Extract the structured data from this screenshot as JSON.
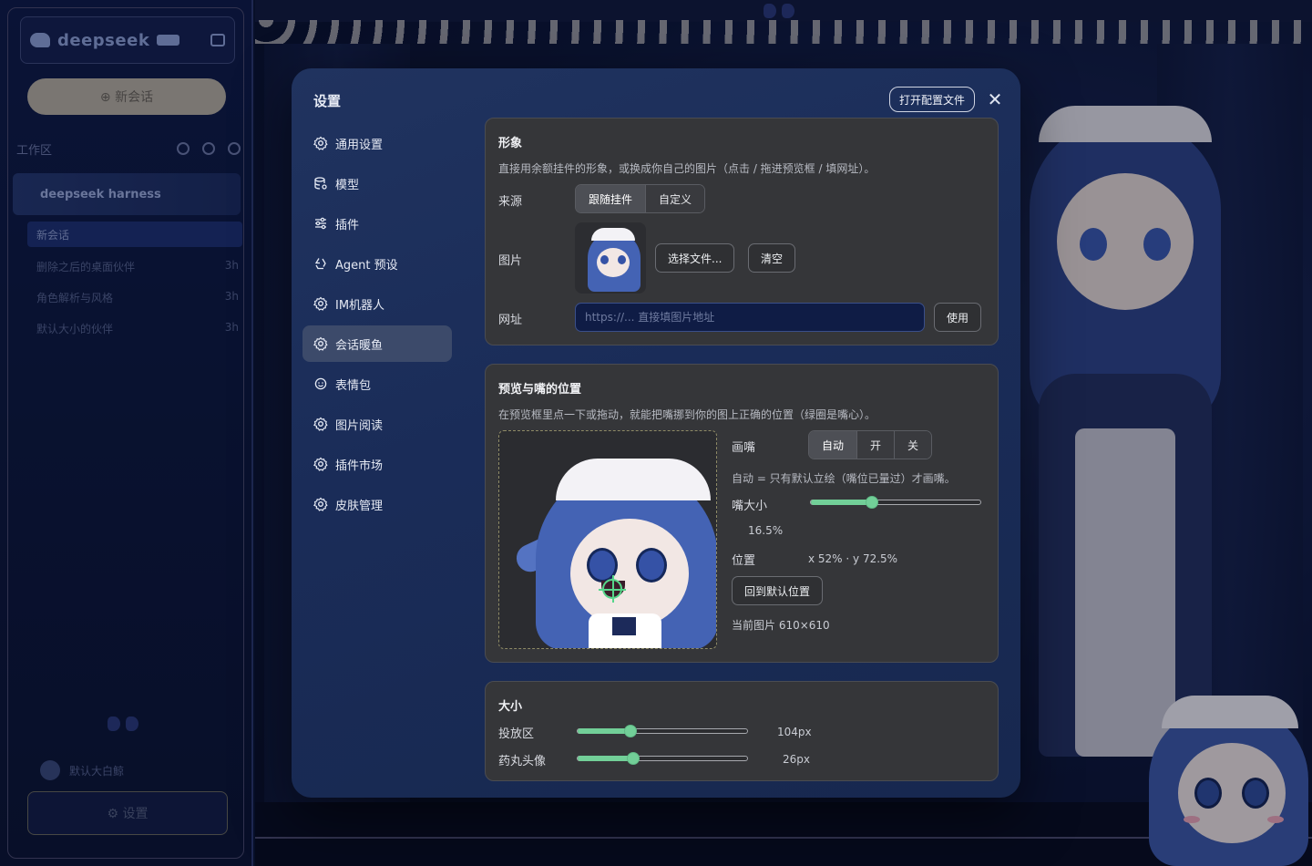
{
  "background": {
    "logo_name": "deepseek",
    "new_chat": "⊕ 新会话",
    "workspace_label": "工作区",
    "project_name": "deepseek harness",
    "session_label": "新会话",
    "sessions": [
      {
        "title": "删除之后的桌面伙伴",
        "time": "3h"
      },
      {
        "title": "角色解析与风格",
        "time": "3h"
      },
      {
        "title": "默认大小的伙伴",
        "time": "3h"
      }
    ],
    "user_name": "默认大白鲸",
    "settings_label": "⚙ 设置"
  },
  "modal": {
    "title": "设置",
    "open_config_label": "打开配置文件",
    "close_symbol": "✕",
    "nav": [
      {
        "label": "通用设置",
        "icon": "gear-icon"
      },
      {
        "label": "模型",
        "icon": "database-icon"
      },
      {
        "label": "插件",
        "icon": "sliders-icon"
      },
      {
        "label": "Agent 预设",
        "icon": "recycle-icon"
      },
      {
        "label": "IM机器人",
        "icon": "gear-icon"
      },
      {
        "label": "会话暖鱼",
        "icon": "gear-icon"
      },
      {
        "label": "表情包",
        "icon": "smile-icon"
      },
      {
        "label": "图片阅读",
        "icon": "gear-icon"
      },
      {
        "label": "插件市场",
        "icon": "gear-icon"
      },
      {
        "label": "皮肤管理",
        "icon": "gear-icon"
      }
    ],
    "active_nav": "会话暖鱼"
  },
  "appearance": {
    "title": "形象",
    "description": "直接用余额挂件的形象，或换成你自己的图片（点击 / 拖进预览框 / 填网址）。",
    "source_label": "来源",
    "source_options": [
      "跟随挂件",
      "自定义"
    ],
    "source_selected": "跟随挂件",
    "image_label": "图片",
    "choose_file_label": "选择文件...",
    "clear_label": "清空",
    "url_label": "网址",
    "url_placeholder": "https://... 直接填图片地址",
    "url_value": "",
    "use_label": "使用"
  },
  "mouth": {
    "title": "预览与嘴的位置",
    "description": "在预览框里点一下或拖动，就能把嘴挪到你的图上正确的位置（绿圈是嘴心）。",
    "draw_mouth_label": "画嘴",
    "draw_mouth_options": [
      "自动",
      "开",
      "关"
    ],
    "draw_mouth_selected": "自动",
    "auto_hint": "自动 = 只有默认立绘（嘴位已量过）才画嘴。",
    "mouth_size_label": "嘴大小",
    "mouth_size_value": "16.5%",
    "mouth_size_fraction": 0.36,
    "position_label": "位置",
    "position_value": "x 52% · y 72.5%",
    "mouth_x": 0.52,
    "mouth_y": 0.725,
    "reset_label": "回到默认位置",
    "current_image": "当前图片 610×610"
  },
  "size": {
    "title": "大小",
    "dropzone_label": "投放区",
    "dropzone_value": "104px",
    "dropzone_fraction": 0.31,
    "avatar_label": "药丸头像",
    "avatar_value": "26px",
    "avatar_fraction": 0.33
  },
  "colors": {
    "accent_green": "#72cf98",
    "modal_bg": "#1a2c58",
    "card_bg": "#353639"
  }
}
